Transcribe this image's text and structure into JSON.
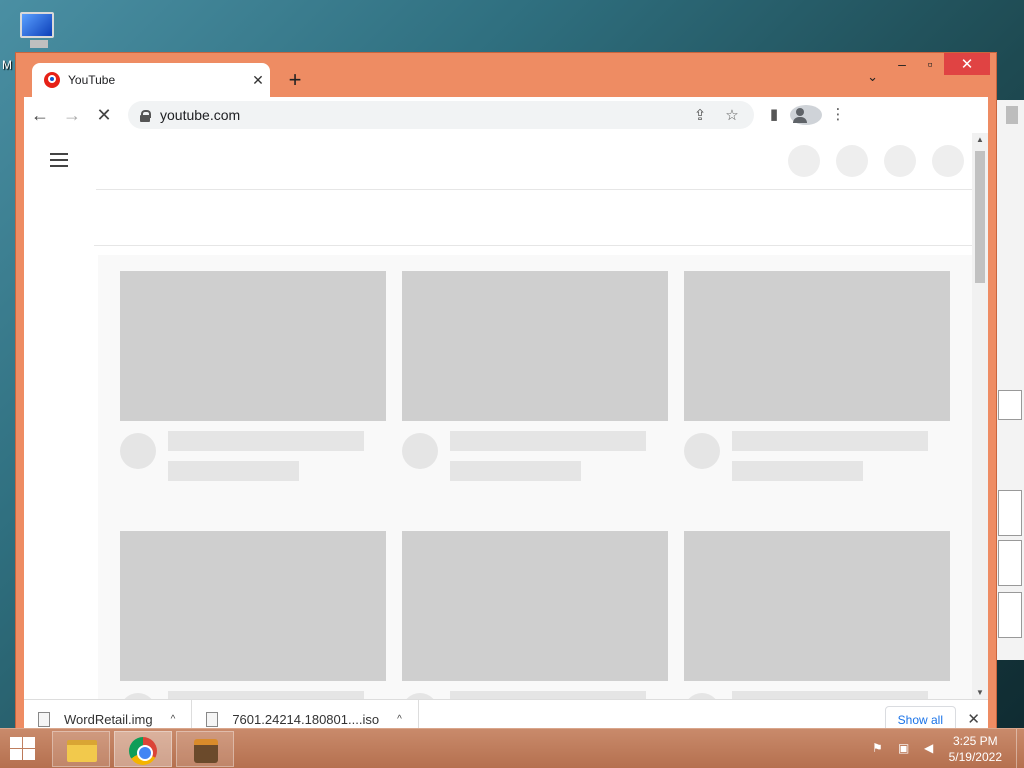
{
  "desktop": {
    "icon_label": "M"
  },
  "browser": {
    "tab_title": "YouTube",
    "new_tab_symbol": "+",
    "tab_close_symbol": "✕",
    "tab_menu_symbol": "⌄",
    "window_controls": {
      "minimize": "–",
      "maximize": "▫",
      "close": "✕"
    },
    "url": "youtube.com",
    "nav": {
      "back": "←",
      "forward": "→",
      "reload": "✕"
    },
    "omnibox_icons": [
      "share-icon",
      "star-icon"
    ],
    "toolbar_icons": [
      "side-panel-icon",
      "profile-icon",
      "menu-icon"
    ]
  },
  "downloads": {
    "items": [
      {
        "name": "WordRetail.img",
        "caret": "^"
      },
      {
        "name": "7601.24214.180801....iso",
        "caret": "^"
      }
    ],
    "show_all": "Show all",
    "close": "✕"
  },
  "taskbar": {
    "time": "3:25 PM",
    "date": "5/19/2022",
    "apps": [
      "file-explorer-icon",
      "chrome-icon",
      "app-icon"
    ]
  }
}
